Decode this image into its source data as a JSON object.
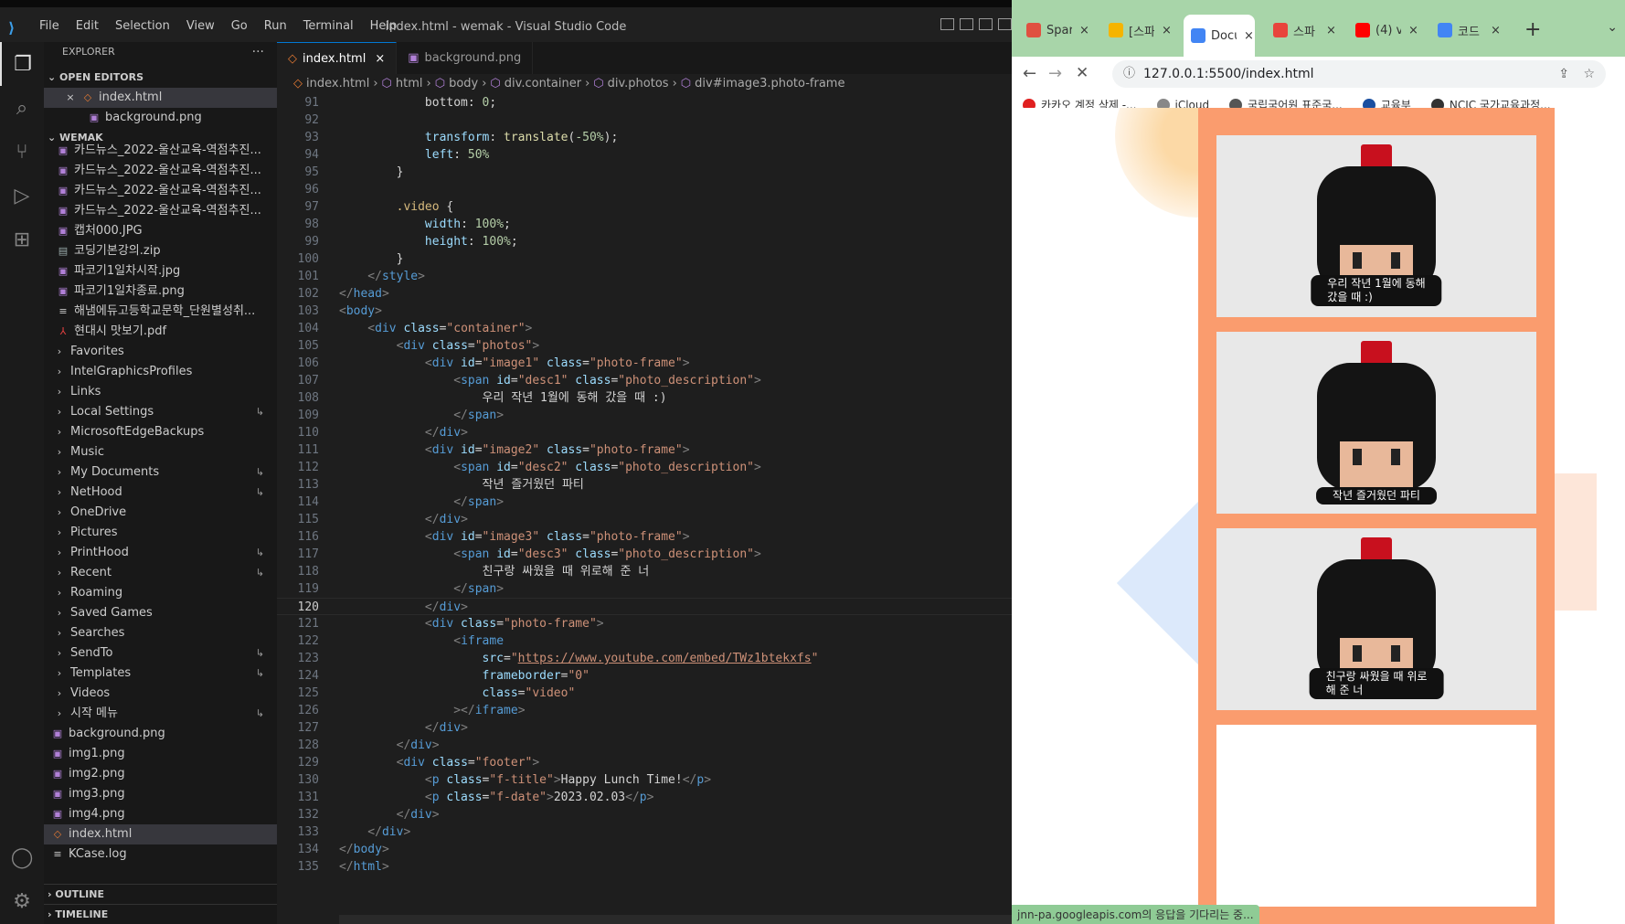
{
  "vscode": {
    "window_title": "index.html - wemak - Visual Studio Code",
    "menu": [
      "File",
      "Edit",
      "Selection",
      "View",
      "Go",
      "Run",
      "Terminal",
      "Help"
    ],
    "explorer_label": "EXPLORER",
    "open_editors_label": "OPEN EDITORS",
    "open_editors": [
      {
        "name": "index.html",
        "type": "html",
        "close": "×"
      },
      {
        "name": "background.png",
        "type": "img"
      }
    ],
    "workspace_label": "WEMAK",
    "files": [
      {
        "name": "카드뉴스_2022-울산교육-역점추진...",
        "type": "img"
      },
      {
        "name": "카드뉴스_2022-울산교육-역점추진...",
        "type": "img"
      },
      {
        "name": "카드뉴스_2022-울산교육-역점추진...",
        "type": "img"
      },
      {
        "name": "카드뉴스_2022-울산교육-역점추진...",
        "type": "img"
      },
      {
        "name": "캡처000.JPG",
        "type": "img"
      },
      {
        "name": "코딩기본강의.zip",
        "type": "zip"
      },
      {
        "name": "파코기1일차시작.jpg",
        "type": "img"
      },
      {
        "name": "파코기1일차종료.png",
        "type": "img"
      },
      {
        "name": "해냄에듀고등학교문학_단원별성취...",
        "type": "doc"
      },
      {
        "name": "현대시 맛보기.pdf",
        "type": "pdf"
      }
    ],
    "folders": [
      {
        "name": "Favorites",
        "mark": ""
      },
      {
        "name": "IntelGraphicsProfiles",
        "mark": ""
      },
      {
        "name": "Links",
        "mark": ""
      },
      {
        "name": "Local Settings",
        "mark": "↳"
      },
      {
        "name": "MicrosoftEdgeBackups",
        "mark": ""
      },
      {
        "name": "Music",
        "mark": ""
      },
      {
        "name": "My Documents",
        "mark": "↳"
      },
      {
        "name": "NetHood",
        "mark": "↳"
      },
      {
        "name": "OneDrive",
        "mark": ""
      },
      {
        "name": "Pictures",
        "mark": ""
      },
      {
        "name": "PrintHood",
        "mark": "↳"
      },
      {
        "name": "Recent",
        "mark": "↳"
      },
      {
        "name": "Roaming",
        "mark": ""
      },
      {
        "name": "Saved Games",
        "mark": ""
      },
      {
        "name": "Searches",
        "mark": ""
      },
      {
        "name": "SendTo",
        "mark": "↳"
      },
      {
        "name": "Templates",
        "mark": "↳"
      },
      {
        "name": "Videos",
        "mark": ""
      },
      {
        "name": "시작 메뉴",
        "mark": "↳"
      }
    ],
    "root_files": [
      {
        "name": "background.png",
        "type": "img"
      },
      {
        "name": "img1.png",
        "type": "img"
      },
      {
        "name": "img2.png",
        "type": "img"
      },
      {
        "name": "img3.png",
        "type": "img"
      },
      {
        "name": "img4.png",
        "type": "img"
      },
      {
        "name": "index.html",
        "type": "html",
        "selected": true
      },
      {
        "name": "KCase.log",
        "type": "log"
      }
    ],
    "outline_label": "OUTLINE",
    "timeline_label": "TIMELINE",
    "tabs": [
      {
        "name": "index.html",
        "active": true,
        "close": "×"
      },
      {
        "name": "background.png",
        "active": false
      }
    ],
    "breadcrumb": [
      "index.html",
      "html",
      "body",
      "div.container",
      "div.photos",
      "div#image3.photo-frame"
    ],
    "current_line": 120,
    "code_start_line": 91,
    "code": [
      [
        [
          "tx",
          "            bottom: "
        ],
        [
          "vl",
          "0"
        ],
        [
          "tx",
          ";"
        ]
      ],
      [],
      [
        [
          "pr",
          "            transform"
        ],
        [
          "tx",
          ": "
        ],
        [
          "fn",
          "translate"
        ],
        [
          "tx",
          "("
        ],
        [
          "vl",
          "-50%"
        ],
        [
          "tx",
          ");"
        ]
      ],
      [
        [
          "pr",
          "            left"
        ],
        [
          "tx",
          ": "
        ],
        [
          "vl",
          "50%"
        ]
      ],
      [
        [
          "tx",
          "        }"
        ]
      ],
      [],
      [
        [
          "sl",
          "        .video"
        ],
        [
          "tx",
          " {"
        ]
      ],
      [
        [
          "pr",
          "            width"
        ],
        [
          "tx",
          ": "
        ],
        [
          "vl",
          "100%"
        ],
        [
          "tx",
          ";"
        ]
      ],
      [
        [
          "pr",
          "            height"
        ],
        [
          "tx",
          ": "
        ],
        [
          "vl",
          "100%"
        ],
        [
          "tx",
          ";"
        ]
      ],
      [
        [
          "tx",
          "        }"
        ]
      ],
      [
        [
          "t",
          "    </"
        ],
        [
          "tn",
          "style"
        ],
        [
          "t",
          ">"
        ]
      ],
      [
        [
          "t",
          "</"
        ],
        [
          "tn",
          "head"
        ],
        [
          "t",
          ">"
        ]
      ],
      [
        [
          "t",
          "<"
        ],
        [
          "tn",
          "body"
        ],
        [
          "t",
          ">"
        ]
      ],
      [
        [
          "t",
          "    <"
        ],
        [
          "tn",
          "div"
        ],
        [
          "at",
          " class"
        ],
        [
          "tx",
          "="
        ],
        [
          "sv",
          "\"container\""
        ],
        [
          "t",
          ">"
        ]
      ],
      [
        [
          "t",
          "        <"
        ],
        [
          "tn",
          "div"
        ],
        [
          "at",
          " class"
        ],
        [
          "tx",
          "="
        ],
        [
          "sv",
          "\"photos\""
        ],
        [
          "t",
          ">"
        ]
      ],
      [
        [
          "t",
          "            <"
        ],
        [
          "tn",
          "div"
        ],
        [
          "at",
          " id"
        ],
        [
          "tx",
          "="
        ],
        [
          "sv",
          "\"image1\""
        ],
        [
          "at",
          " class"
        ],
        [
          "tx",
          "="
        ],
        [
          "sv",
          "\"photo-frame\""
        ],
        [
          "t",
          ">"
        ]
      ],
      [
        [
          "t",
          "                <"
        ],
        [
          "tn",
          "span"
        ],
        [
          "at",
          " id"
        ],
        [
          "tx",
          "="
        ],
        [
          "sv",
          "\"desc1\""
        ],
        [
          "at",
          " class"
        ],
        [
          "tx",
          "="
        ],
        [
          "sv",
          "\"photo_description\""
        ],
        [
          "t",
          ">"
        ]
      ],
      [
        [
          "tx",
          "                    우리 작년 1월에 동해 갔을 때 :)"
        ]
      ],
      [
        [
          "t",
          "                </"
        ],
        [
          "tn",
          "span"
        ],
        [
          "t",
          ">"
        ]
      ],
      [
        [
          "t",
          "            </"
        ],
        [
          "tn",
          "div"
        ],
        [
          "t",
          ">"
        ]
      ],
      [
        [
          "t",
          "            <"
        ],
        [
          "tn",
          "div"
        ],
        [
          "at",
          " id"
        ],
        [
          "tx",
          "="
        ],
        [
          "sv",
          "\"image2\""
        ],
        [
          "at",
          " class"
        ],
        [
          "tx",
          "="
        ],
        [
          "sv",
          "\"photo-frame\""
        ],
        [
          "t",
          ">"
        ]
      ],
      [
        [
          "t",
          "                <"
        ],
        [
          "tn",
          "span"
        ],
        [
          "at",
          " id"
        ],
        [
          "tx",
          "="
        ],
        [
          "sv",
          "\"desc2\""
        ],
        [
          "at",
          " class"
        ],
        [
          "tx",
          "="
        ],
        [
          "sv",
          "\"photo_description\""
        ],
        [
          "t",
          ">"
        ]
      ],
      [
        [
          "tx",
          "                    작년 즐거웠던 파티"
        ]
      ],
      [
        [
          "t",
          "                </"
        ],
        [
          "tn",
          "span"
        ],
        [
          "t",
          ">"
        ]
      ],
      [
        [
          "t",
          "            </"
        ],
        [
          "tn",
          "div"
        ],
        [
          "t",
          ">"
        ]
      ],
      [
        [
          "t",
          "            <"
        ],
        [
          "tn",
          "div"
        ],
        [
          "at",
          " id"
        ],
        [
          "tx",
          "="
        ],
        [
          "sv",
          "\"image3\""
        ],
        [
          "at",
          " class"
        ],
        [
          "tx",
          "="
        ],
        [
          "sv",
          "\"photo-frame\""
        ],
        [
          "t",
          ">"
        ]
      ],
      [
        [
          "t",
          "                <"
        ],
        [
          "tn",
          "span"
        ],
        [
          "at",
          " id"
        ],
        [
          "tx",
          "="
        ],
        [
          "sv",
          "\"desc3\""
        ],
        [
          "at",
          " class"
        ],
        [
          "tx",
          "="
        ],
        [
          "sv",
          "\"photo_description\""
        ],
        [
          "t",
          ">"
        ]
      ],
      [
        [
          "tx",
          "                    친구랑 싸웠을 때 위로해 준 너"
        ]
      ],
      [
        [
          "t",
          "                </"
        ],
        [
          "tn",
          "span"
        ],
        [
          "t",
          ">"
        ]
      ],
      [
        [
          "t",
          "            </"
        ],
        [
          "tn",
          "div"
        ],
        [
          "t",
          ">"
        ]
      ],
      [
        [
          "t",
          "            <"
        ],
        [
          "tn",
          "div"
        ],
        [
          "at",
          " class"
        ],
        [
          "tx",
          "="
        ],
        [
          "sv",
          "\"photo-frame\""
        ],
        [
          "t",
          ">"
        ]
      ],
      [
        [
          "t",
          "                <"
        ],
        [
          "tn",
          "iframe"
        ]
      ],
      [
        [
          "at",
          "                    src"
        ],
        [
          "tx",
          "="
        ],
        [
          "sv",
          "\""
        ],
        [
          "sv ul",
          "https://www.youtube.com/embed/TWz1btekxfs"
        ],
        [
          "sv",
          "\""
        ]
      ],
      [
        [
          "at",
          "                    frameborder"
        ],
        [
          "tx",
          "="
        ],
        [
          "sv",
          "\"0\""
        ]
      ],
      [
        [
          "at",
          "                    class"
        ],
        [
          "tx",
          "="
        ],
        [
          "sv",
          "\"video\""
        ]
      ],
      [
        [
          "t",
          "                ></"
        ],
        [
          "tn",
          "iframe"
        ],
        [
          "t",
          ">"
        ]
      ],
      [
        [
          "t",
          "            </"
        ],
        [
          "tn",
          "div"
        ],
        [
          "t",
          ">"
        ]
      ],
      [
        [
          "t",
          "        </"
        ],
        [
          "tn",
          "div"
        ],
        [
          "t",
          ">"
        ]
      ],
      [
        [
          "t",
          "        <"
        ],
        [
          "tn",
          "div"
        ],
        [
          "at",
          " class"
        ],
        [
          "tx",
          "="
        ],
        [
          "sv",
          "\"footer\""
        ],
        [
          "t",
          ">"
        ]
      ],
      [
        [
          "t",
          "            <"
        ],
        [
          "tn",
          "p"
        ],
        [
          "at",
          " class"
        ],
        [
          "tx",
          "="
        ],
        [
          "sv",
          "\"f-title\""
        ],
        [
          "t",
          ">"
        ],
        [
          "tx",
          "Happy Lunch Time!"
        ],
        [
          "t",
          "</"
        ],
        [
          "tn",
          "p"
        ],
        [
          "t",
          ">"
        ]
      ],
      [
        [
          "t",
          "            <"
        ],
        [
          "tn",
          "p"
        ],
        [
          "at",
          " class"
        ],
        [
          "tx",
          "="
        ],
        [
          "sv",
          "\"f-date\""
        ],
        [
          "t",
          ">"
        ],
        [
          "tx",
          "2023.02.03"
        ],
        [
          "t",
          "</"
        ],
        [
          "tn",
          "p"
        ],
        [
          "t",
          ">"
        ]
      ],
      [
        [
          "t",
          "        </"
        ],
        [
          "tn",
          "div"
        ],
        [
          "t",
          ">"
        ]
      ],
      [
        [
          "t",
          "    </"
        ],
        [
          "tn",
          "div"
        ],
        [
          "t",
          ">"
        ]
      ],
      [
        [
          "t",
          "</"
        ],
        [
          "tn",
          "body"
        ],
        [
          "t",
          ">"
        ]
      ],
      [
        [
          "t",
          "</"
        ],
        [
          "tn",
          "html"
        ],
        [
          "t",
          ">"
        ]
      ]
    ]
  },
  "chrome": {
    "tabs": [
      {
        "title": "Spar",
        "color": "#e05040"
      },
      {
        "title": "[스파",
        "color": "#f5b400"
      },
      {
        "title": "Docu",
        "color": "#4285f4",
        "active": true
      },
      {
        "title": "스파",
        "color": "#e8453c"
      },
      {
        "title": "(4) vi",
        "color": "#ff0000"
      },
      {
        "title": "코드",
        "color": "#4285f4"
      }
    ],
    "tab_close": "×",
    "new_tab": "+",
    "url": "127.0.0.1:5500/index.html",
    "bookmarks": [
      {
        "label": "카카오 계정 삭제 -...",
        "color": "#e02020"
      },
      {
        "label": "iCloud",
        "color": "#888"
      },
      {
        "label": "국립국어원 표준국...",
        "color": "#555"
      },
      {
        "label": "교육부",
        "color": "#1a4fa0"
      },
      {
        "label": "NCIC 국가교육과정...",
        "color": "#333"
      }
    ],
    "photos": [
      {
        "desc": "우리 작년 1월에 동해\n갔을 때 :)"
      },
      {
        "desc": "작년 즐거웠던 파티"
      },
      {
        "desc": "친구랑 싸웠을 때 위로\n해 준 너"
      }
    ],
    "status": "jnn-pa.googleapis.com의 응답을 기다리는 중..."
  }
}
